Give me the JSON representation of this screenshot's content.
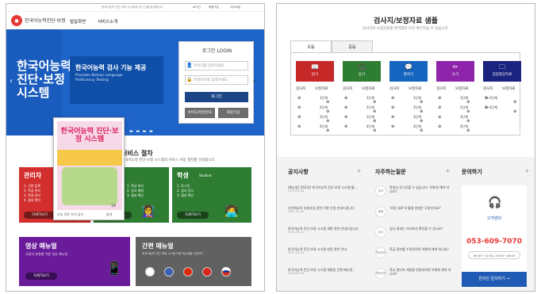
{
  "left": {
    "util_links": [
      "한국어능력 진단·보정 시스템에 오신 것을 환영합니다",
      "로그인",
      "회원가입",
      "사이트맵"
    ],
    "logo_line1": "한국어능력진단·보정",
    "logo_line2": "한국어능력진단·보정",
    "nav": [
      "발달화면",
      "서비스소개"
    ],
    "hero_title": [
      "한국어능력",
      "진단·보정",
      "시스템"
    ],
    "hero_heading": "한국어능력 검사 기능 제공",
    "hero_sub": [
      "Provides Korean Language",
      "Proficiency Testing"
    ],
    "login": {
      "title": "로그인 LOGIN",
      "id_placeholder": "아이디를 입력하세요",
      "pw_placeholder": "비밀번호를 입력하세요",
      "button": "로그인",
      "find": "아이디/비밀번호",
      "join": "회원가입"
    },
    "service_title": "서비스 절차",
    "service_sub": "한국어능력 진단·보정 시스템의 서비스 이용 절차를 안내합니다",
    "popup": {
      "title": "한국어능력 진단·보정 시스템",
      "close": "닫기",
      "dont_show": "오늘 하루 보지 않기",
      "page": "1/6"
    },
    "cards": [
      {
        "title": "관리자",
        "sub": "Admin",
        "lines": [
          "1. 기관 등록",
          "2. 학급 관리",
          "3. 학생 관리",
          "4. 결과 확인"
        ],
        "button": "자세히보기",
        "color": "#d32f2f"
      },
      {
        "title": "교사",
        "sub": "Teacher",
        "lines": [
          "1. 학급 관리",
          "2. 검사 배정",
          "3. 결과 확인"
        ],
        "button": "자세히보기",
        "color": "#2e7d32"
      },
      {
        "title": "학생",
        "sub": "Student",
        "lines": [
          "1. 로그인",
          "2. 검사 응시",
          "3. 결과 확인"
        ],
        "button": "자세히보기",
        "color": "#2e7d32"
      }
    ],
    "video": {
      "title": "영상 매뉴얼",
      "sub": "사용자 유형별 이용 영상 매뉴얼",
      "button": "자세히보기",
      "color": "#6a1b9a"
    },
    "manual": {
      "title": "간편 매뉴얼",
      "sub": "한국어능력 진단·보정 시스템 이용 매뉴얼을 다운로드",
      "color": "#616161"
    }
  },
  "right": {
    "title": "검사지/보정자료 샘플",
    "subtitle": "검사지와 보정자료를 영역별로 미리 확인하실 수 있습니다.",
    "tabs": [
      "초등",
      "중등"
    ],
    "categories": [
      {
        "name": "읽기",
        "icon": "book-icon",
        "color": "#c62828"
      },
      {
        "name": "듣기",
        "icon": "headset-icon",
        "color": "#2e7d32"
      },
      {
        "name": "말하기",
        "icon": "speech-icon",
        "color": "#1565c0"
      },
      {
        "name": "쓰기",
        "icon": "pencil-icon",
        "color": "#8e24aa"
      },
      {
        "name": "집중향상자료",
        "icon": "folder-icon",
        "color": "#1a237e"
      }
    ],
    "col_headers": [
      "검사지",
      "보정자료"
    ],
    "levels": [
      "1단계",
      "2단계",
      "3단계",
      "4단계"
    ],
    "extra_levels": [
      "1~2단계",
      "3~4단계"
    ],
    "notice": {
      "title": "공지사항",
      "items": [
        {
          "text": "[매뉴얼] 2023년 한국어능력 진단·보정 시스템 활...",
          "date": "2023-03-05"
        },
        {
          "text": "다문화교육 지원사업 관련 기관 신청 안내드립니다",
          "date": "2021-03-15"
        },
        {
          "text": "한국어능력 진단·보정 시스템 개편 관련 안내드립니다",
          "date": "2021-03-11"
        },
        {
          "text": "한국어능력 진단·보정 시스템 변경 관련 안내",
          "date": "2021-02-25"
        },
        {
          "text": "한국어능력 진단·보정 시스템 체험용 간편 매뉴얼...",
          "date": "2020-09-03"
        }
      ]
    },
    "faq": {
      "title": "자주하는질문",
      "items": [
        {
          "badge": "검사",
          "text": "학생이 로그인할 수 없습니다. 어떻게 해야 하나요?"
        },
        {
          "badge": "회원",
          "text": "'보정 자료'의 활용 방법은 무엇인가요?"
        },
        {
          "badge": "검사",
          "text": "검사 결과는 어디에서 확인할 수 있나요?"
        },
        {
          "badge": "학교관리",
          "text": "학급 정보를 수정하려면 어떻게 해야 하나요?"
        },
        {
          "badge": "학교관리",
          "text": "학교 관리자 계정을 변경하려면 어떻게 해야 하나요?"
        }
      ]
    },
    "contact": {
      "title": "문의하기",
      "center": "고객센터",
      "phone": "053-609-7070",
      "hours": "09:30~12:00, 13:00~18:00",
      "cta": "온라인 문의하기 →"
    }
  }
}
